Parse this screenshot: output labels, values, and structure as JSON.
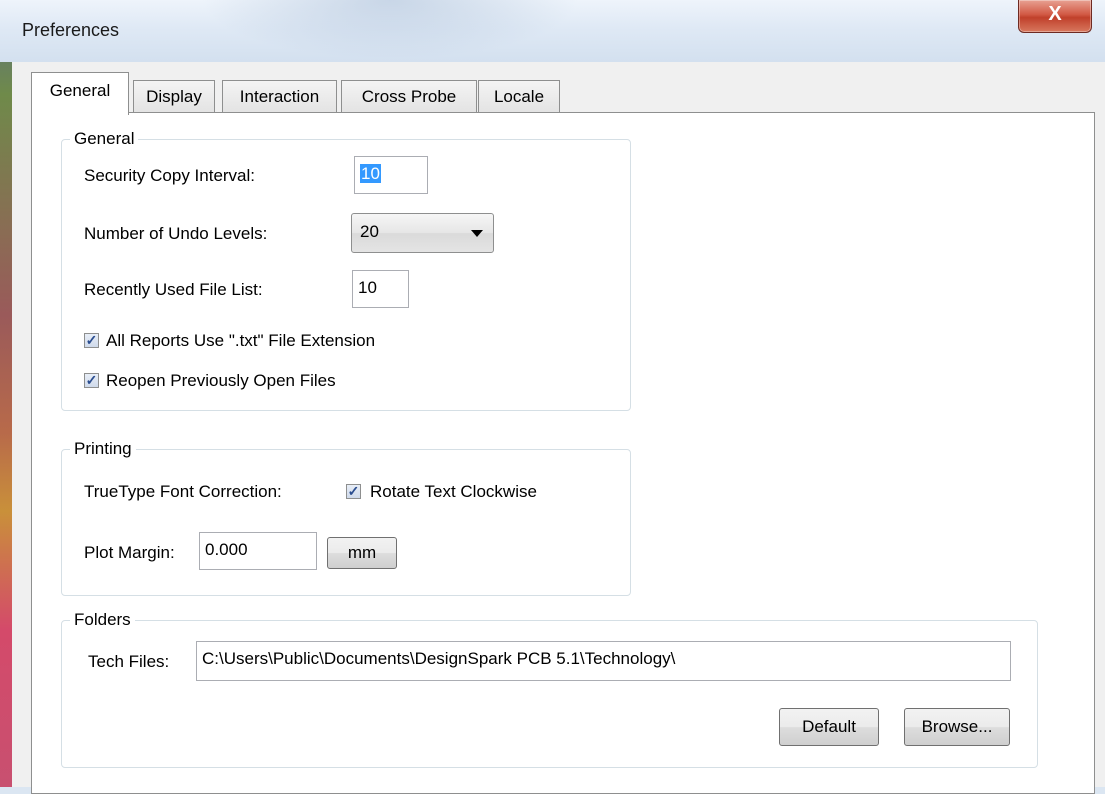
{
  "window": {
    "title": "Preferences",
    "close_label": "X"
  },
  "tabs": [
    {
      "label": "General"
    },
    {
      "label": "Display"
    },
    {
      "label": "Interaction"
    },
    {
      "label": "Cross Probe"
    },
    {
      "label": "Locale"
    }
  ],
  "general_group": {
    "title": "General",
    "security_copy_interval": {
      "label": "Security Copy Interval:",
      "value": "10"
    },
    "undo_levels": {
      "label": "Number of Undo Levels:",
      "value": "20"
    },
    "recent_files": {
      "label": "Recently Used File List:",
      "value": "10"
    },
    "txt_extension": {
      "label": "All Reports Use \".txt\" File Extension",
      "checked": true
    },
    "reopen_files": {
      "label": "Reopen Previously Open Files",
      "checked": true
    }
  },
  "printing_group": {
    "title": "Printing",
    "truetype_label": "TrueType Font Correction:",
    "rotate_text": {
      "label": "Rotate Text Clockwise",
      "checked": true
    },
    "plot_margin_label": "Plot Margin:",
    "plot_margin_value": "0.000",
    "units_button": "mm"
  },
  "folders_group": {
    "title": "Folders",
    "tech_files_label": "Tech Files:",
    "tech_files_value": "C:\\Users\\Public\\Documents\\DesignSpark PCB 5.1\\Technology\\",
    "default_button": "Default",
    "browse_button": "Browse..."
  },
  "check_glyph": "✓"
}
